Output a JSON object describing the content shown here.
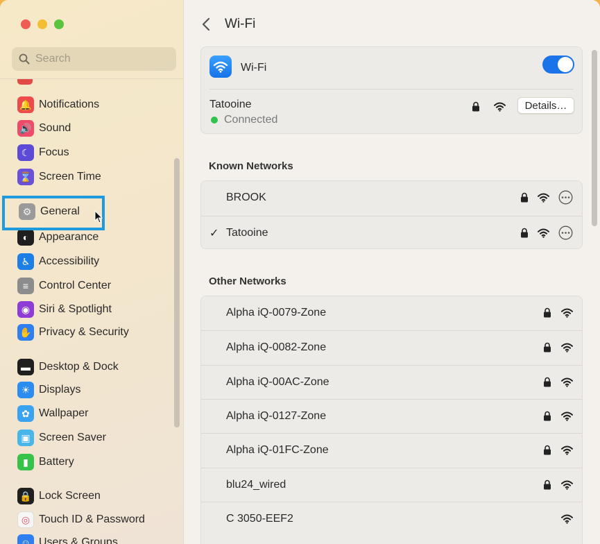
{
  "window": {
    "title": "Wi-Fi"
  },
  "sidebar": {
    "search_placeholder": "Search",
    "items": [
      {
        "label": "Notifications",
        "icon": "bell-icon",
        "color": "#ee4b4b"
      },
      {
        "label": "Sound",
        "icon": "speaker-icon",
        "color": "#ee4b6a"
      },
      {
        "label": "Focus",
        "icon": "moon-icon",
        "color": "#5b4bd6"
      },
      {
        "label": "Screen Time",
        "icon": "hourglass-icon",
        "color": "#6a52d8"
      },
      {
        "label": "General",
        "icon": "gear-icon",
        "color": "#9a9a9a"
      },
      {
        "label": "Appearance",
        "icon": "appearance-icon",
        "color": "#1f1f1f"
      },
      {
        "label": "Accessibility",
        "icon": "accessibility-icon",
        "color": "#1d7fe6"
      },
      {
        "label": "Control Center",
        "icon": "control-center-icon",
        "color": "#8c8c8c"
      },
      {
        "label": "Siri & Spotlight",
        "icon": "siri-icon",
        "color": "#8e3cd6"
      },
      {
        "label": "Privacy & Security",
        "icon": "hand-icon",
        "color": "#2f7ff0"
      },
      {
        "label": "Desktop & Dock",
        "icon": "dock-icon",
        "color": "#1f1f1f"
      },
      {
        "label": "Displays",
        "icon": "sun-icon",
        "color": "#2d8cf0"
      },
      {
        "label": "Wallpaper",
        "icon": "flower-icon",
        "color": "#3aa3ef"
      },
      {
        "label": "Screen Saver",
        "icon": "screen-saver-icon",
        "color": "#48b6e8"
      },
      {
        "label": "Battery",
        "icon": "battery-icon",
        "color": "#37c24a"
      },
      {
        "label": "Lock Screen",
        "icon": "lock-icon",
        "color": "#1f1f1f"
      },
      {
        "label": "Touch ID & Password",
        "icon": "fingerprint-icon",
        "color": "#f6f6f6"
      },
      {
        "label": "Users & Groups",
        "icon": "users-icon",
        "color": "#2f7ff0"
      }
    ]
  },
  "wifi": {
    "label": "Wi-Fi",
    "enabled": true,
    "current_network": "Tatooine",
    "status": "Connected",
    "details_label": "Details…"
  },
  "known_networks": {
    "title": "Known Networks",
    "items": [
      {
        "name": "BROOK",
        "checked": false
      },
      {
        "name": "Tatooine",
        "checked": true
      }
    ]
  },
  "other_networks": {
    "title": "Other Networks",
    "items": [
      {
        "name": "Alpha iQ-0079-Zone",
        "locked": true
      },
      {
        "name": "Alpha iQ-0082-Zone",
        "locked": true
      },
      {
        "name": "Alpha iQ-00AC-Zone",
        "locked": true
      },
      {
        "name": "Alpha iQ-0127-Zone",
        "locked": true
      },
      {
        "name": "Alpha iQ-01FC-Zone",
        "locked": true
      },
      {
        "name": "blu24_wired",
        "locked": true
      },
      {
        "name": "C 3050-EEF2",
        "locked": false
      }
    ]
  },
  "colors": {
    "accent": "#1a73e8",
    "highlight": "#1e9bdf",
    "connected": "#33c24d"
  }
}
